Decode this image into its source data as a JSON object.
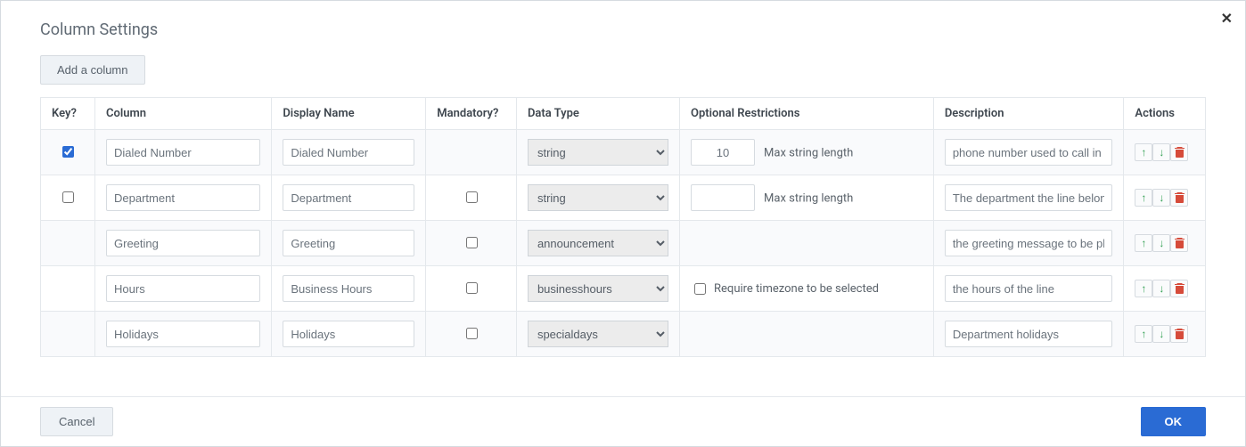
{
  "title": "Column Settings",
  "buttons": {
    "add": "Add a column",
    "cancel": "Cancel",
    "ok": "OK"
  },
  "headers": {
    "key": "Key?",
    "column": "Column",
    "display": "Display Name",
    "mandatory": "Mandatory?",
    "datatype": "Data Type",
    "optional": "Optional Restrictions",
    "description": "Description",
    "actions": "Actions"
  },
  "labels": {
    "maxStringLength": "Max string length",
    "requireTimezone": "Require timezone to be selected"
  },
  "datatypeOptions": [
    "string",
    "announcement",
    "businesshours",
    "specialdays"
  ],
  "rows": [
    {
      "key": true,
      "showKey": true,
      "column": "Dialed Number",
      "display": "Dialed Number",
      "mandatory": null,
      "datatype": "string",
      "restriction": {
        "type": "maxlen",
        "value": "10"
      },
      "description": "phone number used to call in to"
    },
    {
      "key": false,
      "showKey": true,
      "column": "Department",
      "display": "Department",
      "mandatory": false,
      "datatype": "string",
      "restriction": {
        "type": "maxlen",
        "value": ""
      },
      "description": "The department the line belong"
    },
    {
      "key": null,
      "showKey": false,
      "column": "Greeting",
      "display": "Greeting",
      "mandatory": false,
      "datatype": "announcement",
      "restriction": {
        "type": "none"
      },
      "description": "the greeting message to be pla"
    },
    {
      "key": null,
      "showKey": false,
      "column": "Hours",
      "display": "Business Hours",
      "mandatory": false,
      "datatype": "businesshours",
      "restriction": {
        "type": "timezone",
        "checked": false
      },
      "description": "the hours of the line"
    },
    {
      "key": null,
      "showKey": false,
      "column": "Holidays",
      "display": "Holidays",
      "mandatory": false,
      "datatype": "specialdays",
      "restriction": {
        "type": "none"
      },
      "description": "Department holidays"
    }
  ]
}
